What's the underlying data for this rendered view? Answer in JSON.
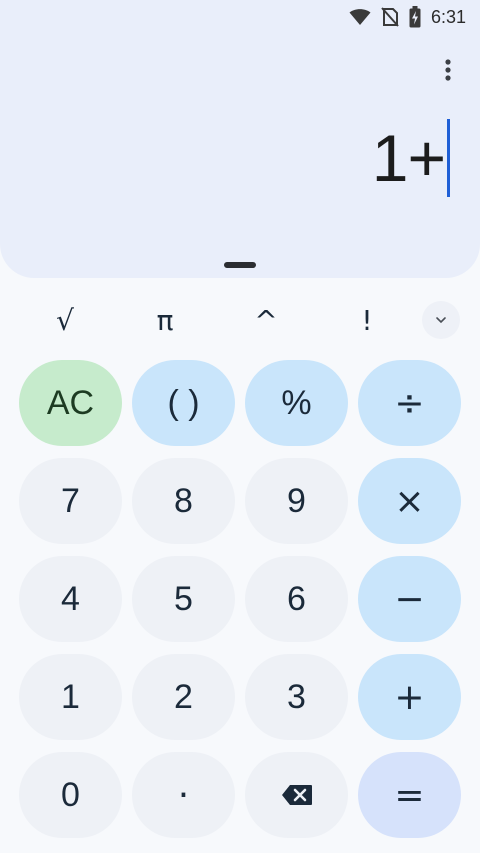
{
  "status_bar": {
    "time": "6:31",
    "icons": [
      "wifi-icon",
      "no-sim-icon",
      "battery-charging-icon"
    ]
  },
  "display": {
    "expression": "1+",
    "menu_icon": "more-vert-icon"
  },
  "scientific_row": {
    "keys": [
      "√",
      "π",
      "^",
      "!"
    ],
    "expand_icon": "chevron-down-icon"
  },
  "keypad": {
    "ac": "AC",
    "parens": "( )",
    "percent": "%",
    "divide": "÷",
    "seven": "7",
    "eight": "8",
    "nine": "9",
    "multiply": "×",
    "four": "4",
    "five": "5",
    "six": "6",
    "minus": "−",
    "one": "1",
    "two": "2",
    "three": "3",
    "plus": "+",
    "zero": "0",
    "decimal": "·",
    "backspace_icon": "backspace-icon",
    "equals": "="
  },
  "colors": {
    "display_bg": "#e9eefa",
    "number_key": "#eef1f6",
    "operator_key": "#c9e5fb",
    "ac_key": "#c6ebcc",
    "equals_key": "#d6e2fb",
    "cursor": "#1f5fd6"
  }
}
